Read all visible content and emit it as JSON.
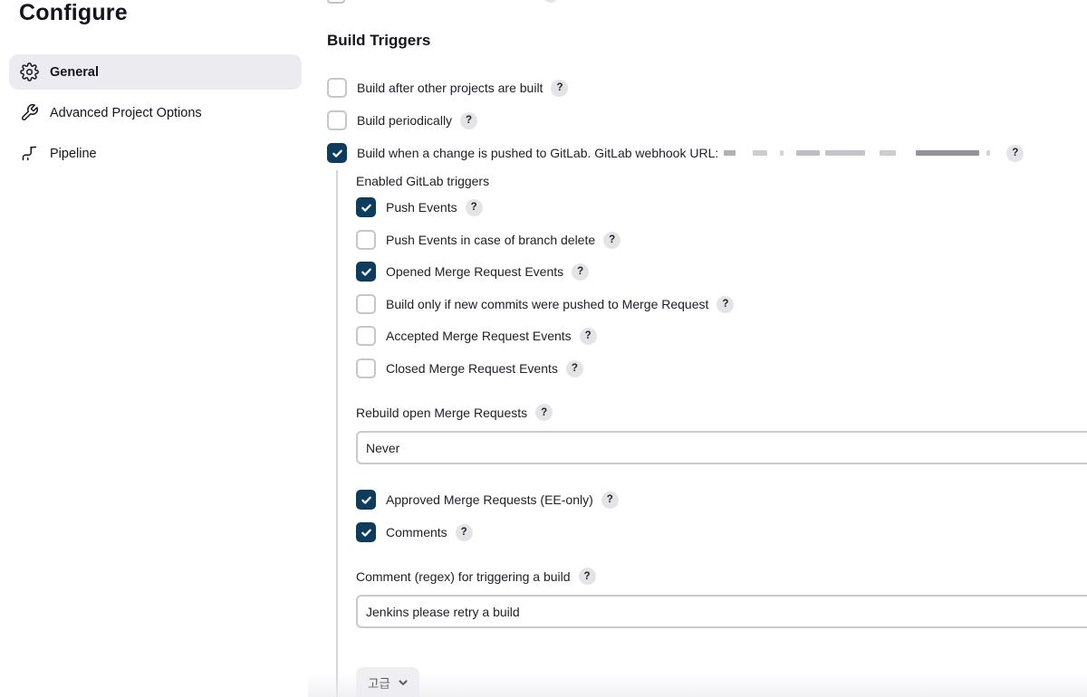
{
  "page": {
    "title": "Configure"
  },
  "sidebar": {
    "items": [
      {
        "label": "General",
        "icon": "gear-icon",
        "active": true
      },
      {
        "label": "Advanced Project Options",
        "icon": "wrench-icon",
        "active": false
      },
      {
        "label": "Pipeline",
        "icon": "pipeline-icon",
        "active": false
      }
    ]
  },
  "build_triggers": {
    "title": "Build Triggers",
    "options": [
      {
        "label": "Build after other projects are built",
        "checked": false
      },
      {
        "label": "Build periodically",
        "checked": false
      },
      {
        "label": "Build when a change is pushed to GitLab. GitLab webhook URL:",
        "checked": true
      }
    ],
    "gitlab": {
      "enabled_label": "Enabled GitLab triggers",
      "events": [
        {
          "label": "Push Events",
          "checked": true
        },
        {
          "label": "Push Events in case of branch delete",
          "checked": false
        },
        {
          "label": "Opened Merge Request Events",
          "checked": true
        },
        {
          "label": "Build only if new commits were pushed to Merge Request",
          "checked": false
        },
        {
          "label": "Accepted Merge Request Events",
          "checked": false
        },
        {
          "label": "Closed Merge Request Events",
          "checked": false
        }
      ],
      "rebuild_label": "Rebuild open Merge Requests",
      "rebuild_value": "Never",
      "extra": [
        {
          "label": "Approved Merge Requests (EE-only)",
          "checked": true
        },
        {
          "label": "Comments",
          "checked": true
        }
      ],
      "comment_label": "Comment (regex) for triggering a build",
      "comment_value": "Jenkins please retry a build",
      "advanced_label": "고급"
    }
  },
  "help_glyph": "?",
  "colors": {
    "checkbox_checked": "#0e3c5e",
    "active_nav": "#ececf0"
  }
}
